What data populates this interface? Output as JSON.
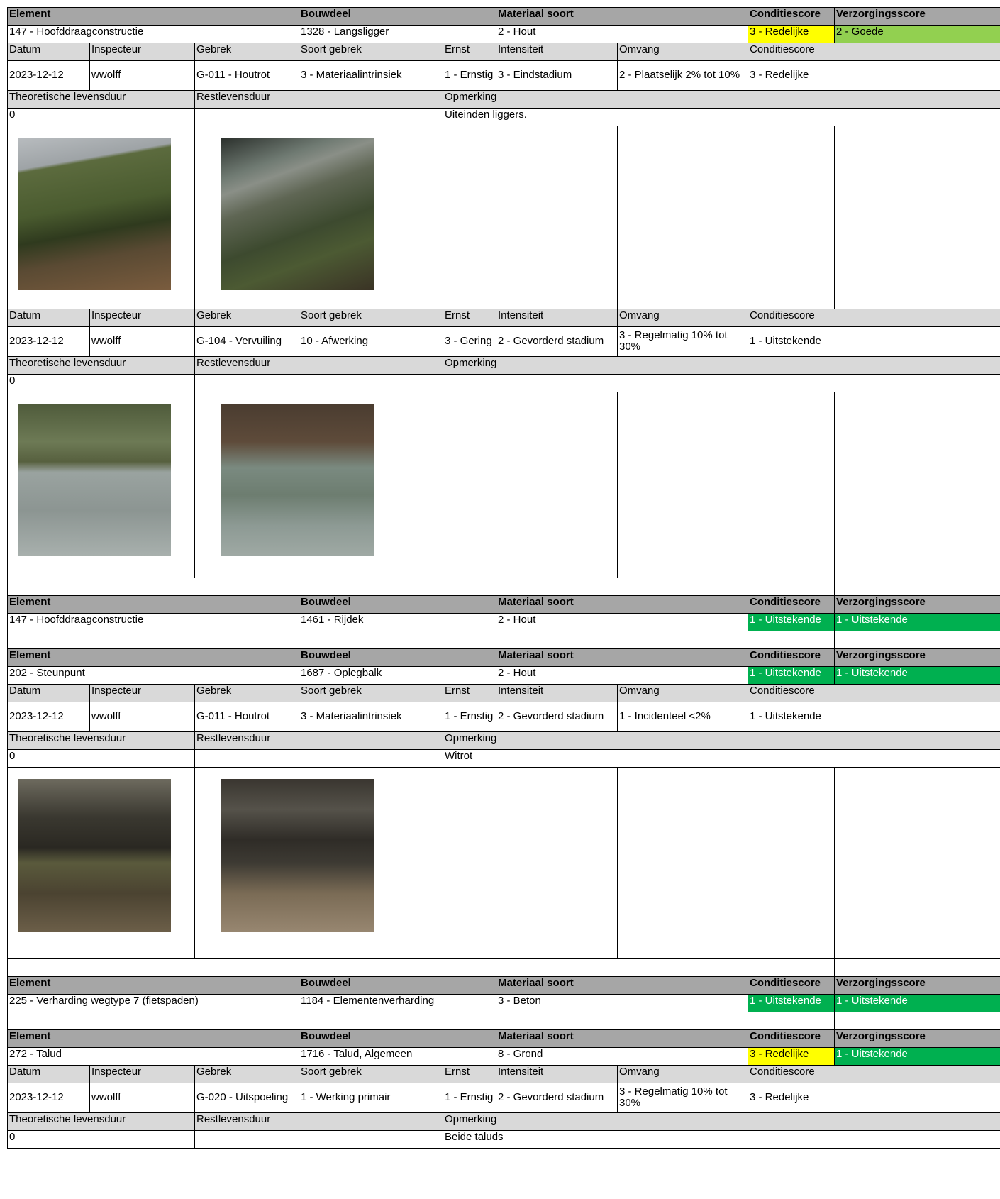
{
  "headers": {
    "element": "Element",
    "bouwdeel": "Bouwdeel",
    "materiaal": "Materiaal soort",
    "conditiescore": "Conditiescore",
    "verzorgingsscore": "Verzorgingsscore",
    "datum": "Datum",
    "inspecteur": "Inspecteur",
    "gebrek": "Gebrek",
    "soort_gebrek": "Soort gebrek",
    "ernst": "Ernst",
    "intensiteit": "Intensiteit",
    "omvang": "Omvang",
    "theoretische": "Theoretische levensduur",
    "restlevensduur": "Restlevensduur",
    "opmerking": "Opmerking"
  },
  "blocks": [
    {
      "element": "147 - Hoofddraagconstructie",
      "bouwdeel": "1328 - Langsligger",
      "materiaal": "2 - Hout",
      "conditiescore": "3 - Redelijke",
      "verzorgingsscore": "2 - Goede",
      "defects": [
        {
          "datum": "2023-12-12",
          "inspecteur": "wwolff",
          "gebrek": "G-011 - Houtrot",
          "soort_gebrek": "3 - Materiaalintrinsiek",
          "ernst": "1 - Ernstig",
          "intensiteit": "3 - Eindstadium",
          "omvang": "2 - Plaatselijk 2% tot 10%",
          "conditiescore": "3 - Redelijke",
          "theoretische": "0",
          "restlevensduur": "",
          "opmerking": "Uiteinden liggers.",
          "photos": [
            "photo-rotten-beam-screwdriver",
            "photo-bridge-deck-end"
          ]
        },
        {
          "datum": "2023-12-12",
          "inspecteur": "wwolff",
          "gebrek": "G-104 - Vervuiling",
          "soort_gebrek": "10 - Afwerking",
          "ernst": "3 - Gering",
          "intensiteit": "2 - Gevorderd stadium",
          "omvang": "3 - Regelmatig 10% tot 30%",
          "conditiescore": "1 - Uitstekende",
          "theoretische": "0",
          "restlevensduur": "",
          "opmerking": "",
          "photos": [
            "photo-beam-over-water",
            "photo-under-bridge-water"
          ]
        }
      ]
    },
    {
      "element": "147 - Hoofddraagconstructie",
      "bouwdeel": "1461 - Rijdek",
      "materiaal": "2 - Hout",
      "conditiescore": "1 - Uitstekende",
      "verzorgingsscore": "1 - Uitstekende",
      "defects": []
    },
    {
      "element": "202 - Steunpunt",
      "bouwdeel": "1687 - Oplegbalk",
      "materiaal": "2 - Hout",
      "conditiescore": "1 - Uitstekende",
      "verzorgingsscore": "1 - Uitstekende",
      "defects": [
        {
          "datum": "2023-12-12",
          "inspecteur": "wwolff",
          "gebrek": "G-011 - Houtrot",
          "soort_gebrek": "3 - Materiaalintrinsiek",
          "ernst": "1 - Ernstig",
          "intensiteit": "2 - Gevorderd stadium",
          "omvang": "1 - Incidenteel <2%",
          "conditiescore": "1 - Uitstekende",
          "theoretische": "0",
          "restlevensduur": "",
          "opmerking": "Witrot",
          "photos": [
            "photo-support-beam-grass",
            "photo-support-beam-pipes"
          ]
        }
      ]
    },
    {
      "element": "225 - Verharding wegtype 7 (fietspaden)",
      "bouwdeel": "1184 - Elementenverharding",
      "materiaal": "3 - Beton",
      "conditiescore": "1 - Uitstekende",
      "verzorgingsscore": "1 - Uitstekende",
      "defects": []
    },
    {
      "element": "272 - Talud",
      "bouwdeel": "1716 - Talud, Algemeen",
      "materiaal": "8 - Grond",
      "conditiescore": "3 - Redelijke",
      "verzorgingsscore": "1 - Uitstekende",
      "defects": [
        {
          "datum": "2023-12-12",
          "inspecteur": "wwolff",
          "gebrek": "G-020 - Uitspoeling",
          "soort_gebrek": "1 - Werking primair",
          "ernst": "1 - Ernstig",
          "intensiteit": "2 - Gevorderd stadium",
          "omvang": "3 - Regelmatig 10% tot 30%",
          "conditiescore": "3 - Redelijke",
          "theoretische": "0",
          "restlevensduur": "",
          "opmerking": "Beide taluds",
          "photos": []
        }
      ]
    }
  ],
  "colors": {
    "header_bg": "#a6a6a6",
    "label_bg": "#d9d9d9",
    "score_redelijke": "#ffff00",
    "score_goede": "#92d050",
    "score_uitstekende": "#00b050"
  }
}
